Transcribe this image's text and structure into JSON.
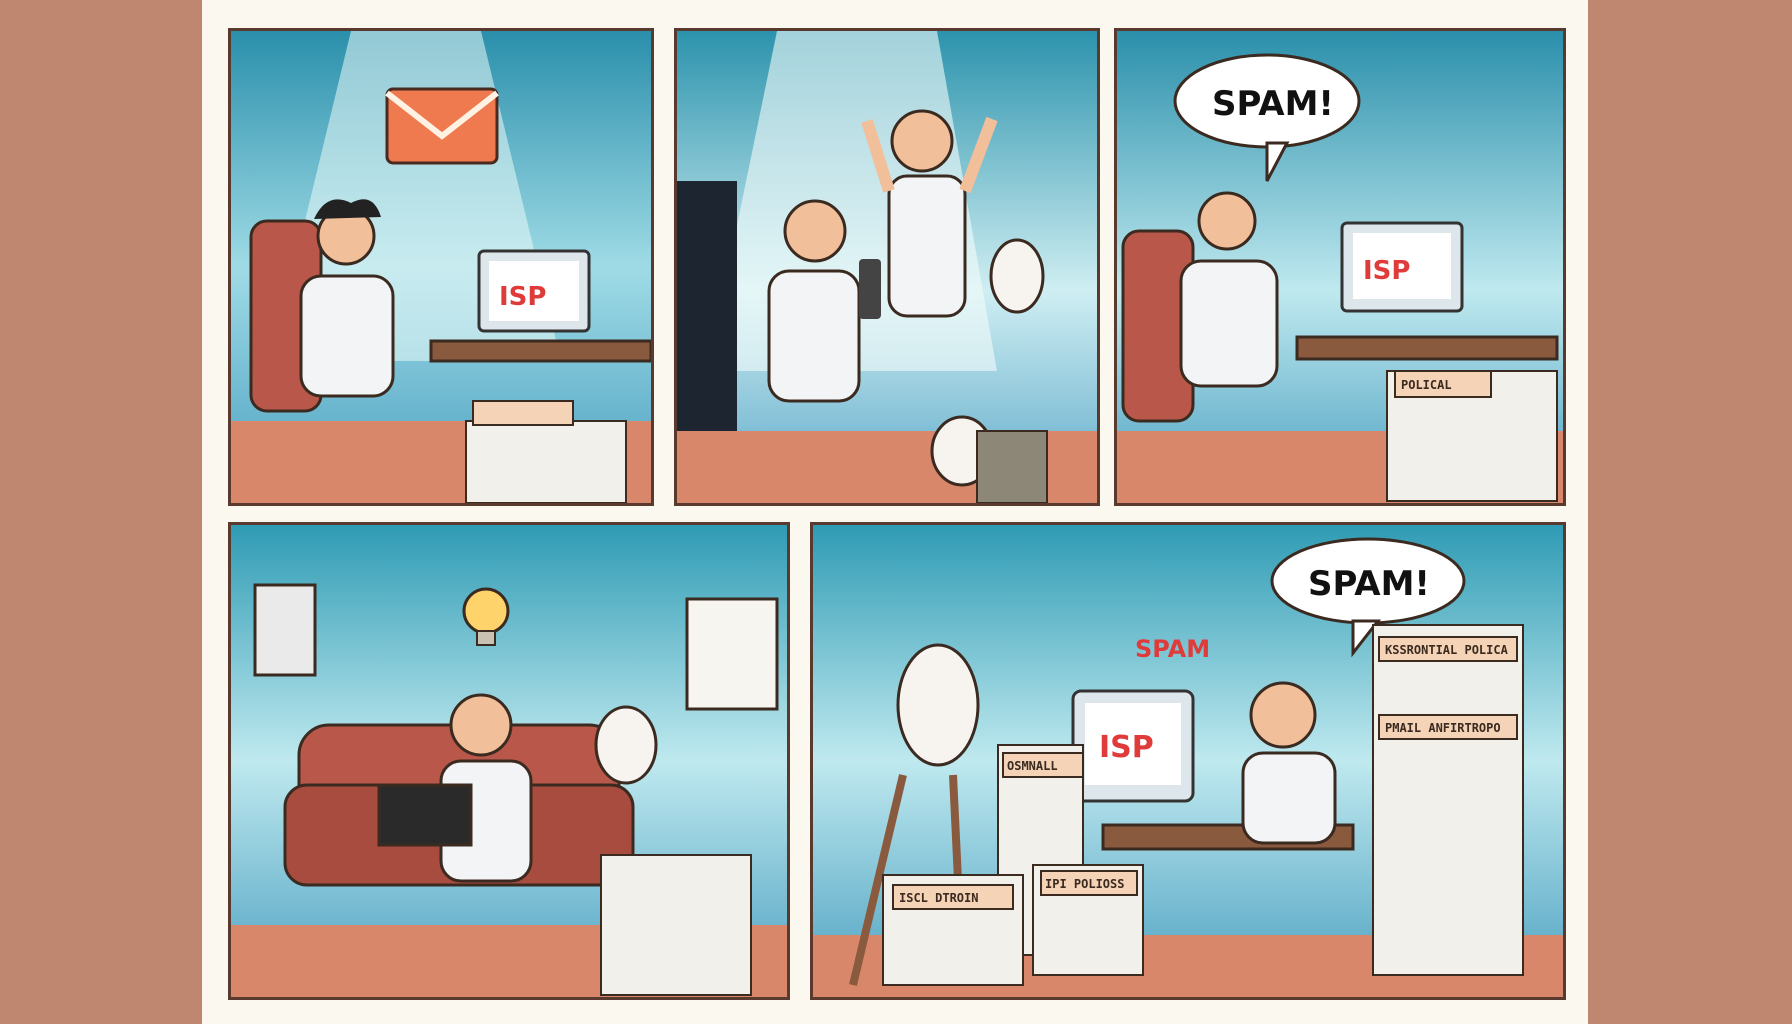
{
  "panels": {
    "p1": {
      "monitor_text": "ISP"
    },
    "p3": {
      "speech": "SPAM!",
      "monitor_text": "ISP",
      "label_top": "POLICAL"
    },
    "p5": {
      "speech": "SPAM!",
      "shout": "SPAM",
      "monitor_text": "ISP",
      "label_a": "KSSRONTIAL POLICA",
      "label_b": "PMAIL  ANFIRTROPO",
      "label_c": "OSMNALL",
      "label_d": "ISCL  DTROIN",
      "label_e": "IPI  POLIOSS"
    }
  },
  "colors": {
    "wall_top": "#2f9bb4",
    "wall_light": "#cfeef2",
    "floor": "#d9876a",
    "accent_red": "#e03b3b"
  }
}
